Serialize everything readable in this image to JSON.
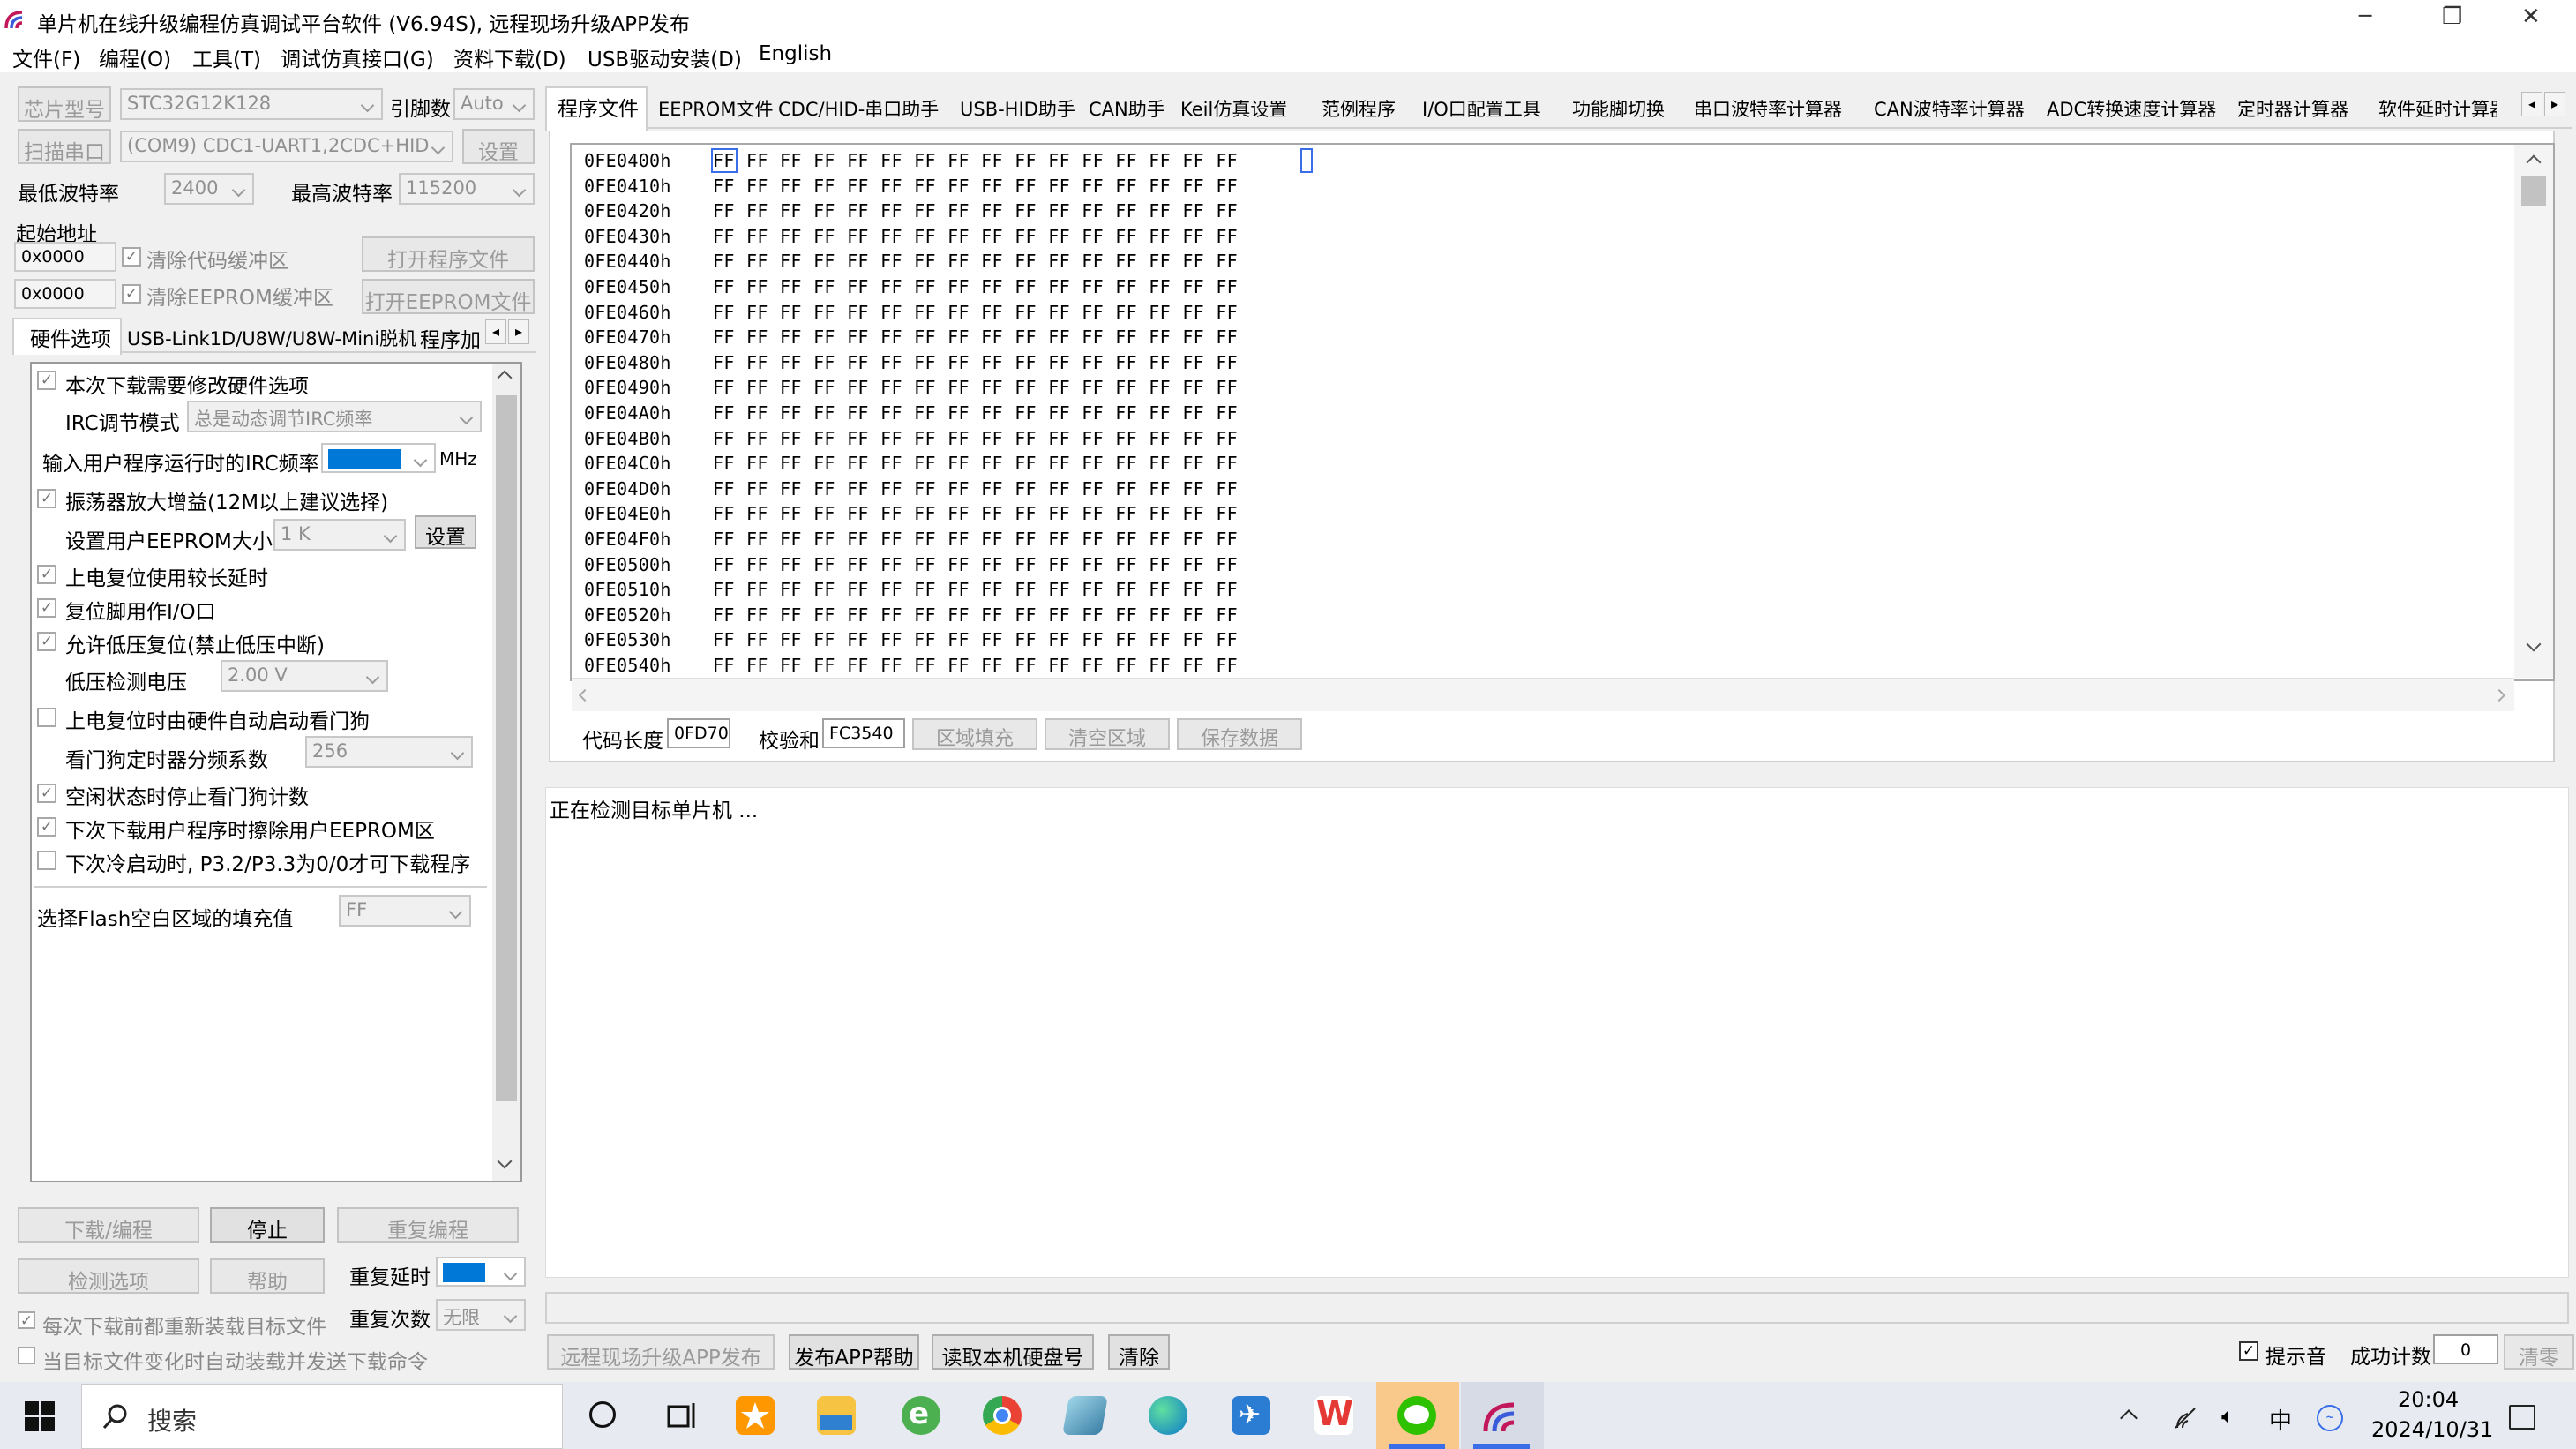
{
  "window": {
    "title": "单片机在线升级编程仿真调试平台软件 (V6.94S), 远程现场升级APP发布",
    "min": "─",
    "max": "❐",
    "close": "✕"
  },
  "menu": [
    "文件(F)",
    "编程(O)",
    "工具(T)",
    "调试仿真接口(G)",
    "资料下载(D)",
    "USB驱动安装(D)",
    "English"
  ],
  "left": {
    "chip_btn": "芯片型号",
    "chip_value": "STC32G12K128",
    "pins_label": "引脚数",
    "pins_value": "Auto",
    "scan_btn": "扫描串口",
    "port_value": "(COM9) CDC1-UART1,2CDC+HID",
    "settings_btn": "设置",
    "min_baud_label": "最低波特率",
    "min_baud": "2400",
    "max_baud_label": "最高波特率",
    "max_baud": "115200",
    "start_addr_label": "起始地址",
    "addr1": "0x0000",
    "clear_code": "清除代码缓冲区",
    "open_prog_btn": "打开程序文件",
    "addr2": "0x0000",
    "clear_eeprom": "清除EEPROM缓冲区",
    "open_eeprom_btn": "打开EEPROM文件",
    "tabs": [
      "硬件选项",
      "USB-Link1D/U8W/U8W-Mini脱机",
      "程序加"
    ],
    "hw": {
      "opt1": "本次下载需要修改硬件选项",
      "irc_mode_label": "IRC调节模式",
      "irc_mode": "总是动态调节IRC频率",
      "irc_freq_label": "输入用户程序运行时的IRC频率",
      "irc_unit": "MHz",
      "osc": "振荡器放大增益(12M以上建议选择)",
      "eeprom_label": "设置用户EEPROM大小",
      "eeprom_size": "1  K",
      "eeprom_btn": "设置",
      "opt_long_delay": "上电复位使用较长延时",
      "opt_reset_io": "复位脚用作I/O口",
      "opt_lvr": "允许低压复位(禁止低压中断)",
      "lvd_label": "低压检测电压",
      "lvd_value": "2.00 V",
      "opt_wdt": "上电复位时由硬件自动启动看门狗",
      "wdt_div_label": "看门狗定时器分频系数",
      "wdt_div": "256",
      "opt_idle_wdt": "空闲状态时停止看门狗计数",
      "opt_erase_eeprom": "下次下载用户程序时擦除用户EEPROM区",
      "opt_cold": "下次冷启动时, P3.2/P3.3为0/0才可下载程序",
      "fill_label": "选择Flash空白区域的填充值",
      "fill_value": "FF"
    },
    "download_btn": "下载/编程",
    "stop_btn": "停止",
    "reprog_btn": "重复编程",
    "check_btn": "检测选项",
    "help_btn": "帮助",
    "repeat_delay_label": "重复延时",
    "repeat_count_label": "重复次数",
    "repeat_count": "无限",
    "reload_label": "每次下载前都重新装载目标文件",
    "auto_send_label": "当目标文件变化时自动装载并发送下载命令"
  },
  "right": {
    "tabs": [
      "程序文件",
      "EEPROM文件",
      "CDC/HID-串口助手",
      "USB-HID助手",
      "CAN助手",
      "Keil仿真设置",
      "范例程序",
      "I/O口配置工具",
      "功能脚切换",
      "串口波特率计算器",
      "CAN波特率计算器",
      "ADC转换速度计算器",
      "定时器计算器",
      "软件延时计算器"
    ],
    "hex_addresses": [
      "0FE0400h",
      "0FE0410h",
      "0FE0420h",
      "0FE0430h",
      "0FE0440h",
      "0FE0450h",
      "0FE0460h",
      "0FE0470h",
      "0FE0480h",
      "0FE0490h",
      "0FE04A0h",
      "0FE04B0h",
      "0FE04C0h",
      "0FE04D0h",
      "0FE04E0h",
      "0FE04F0h",
      "0FE0500h",
      "0FE0510h",
      "0FE0520h",
      "0FE0530h",
      "0FE0540h"
    ],
    "hex_bytes": "FF FF FF FF FF FF FF FF FF FF FF FF FF FF FF FF",
    "code_len_label": "代码长度",
    "code_len": "0FD70",
    "checksum_label": "校验和",
    "checksum": "FC3540",
    "fill_btn": "区域填充",
    "clear_area_btn": "清空区域",
    "save_btn": "保存数据",
    "log": "正在检测目标单片机 ...",
    "remote_btn": "远程现场升级APP发布",
    "app_help_btn": "发布APP帮助",
    "read_disk_btn": "读取本机硬盘号",
    "clear_btn": "清除",
    "beep_label": "提示音",
    "success_label": "成功计数",
    "success_count": "0",
    "clear_count_btn": "清零"
  },
  "taskbar": {
    "search": "搜索",
    "time": "20:04",
    "date": "2024/10/31",
    "ime": "中"
  }
}
